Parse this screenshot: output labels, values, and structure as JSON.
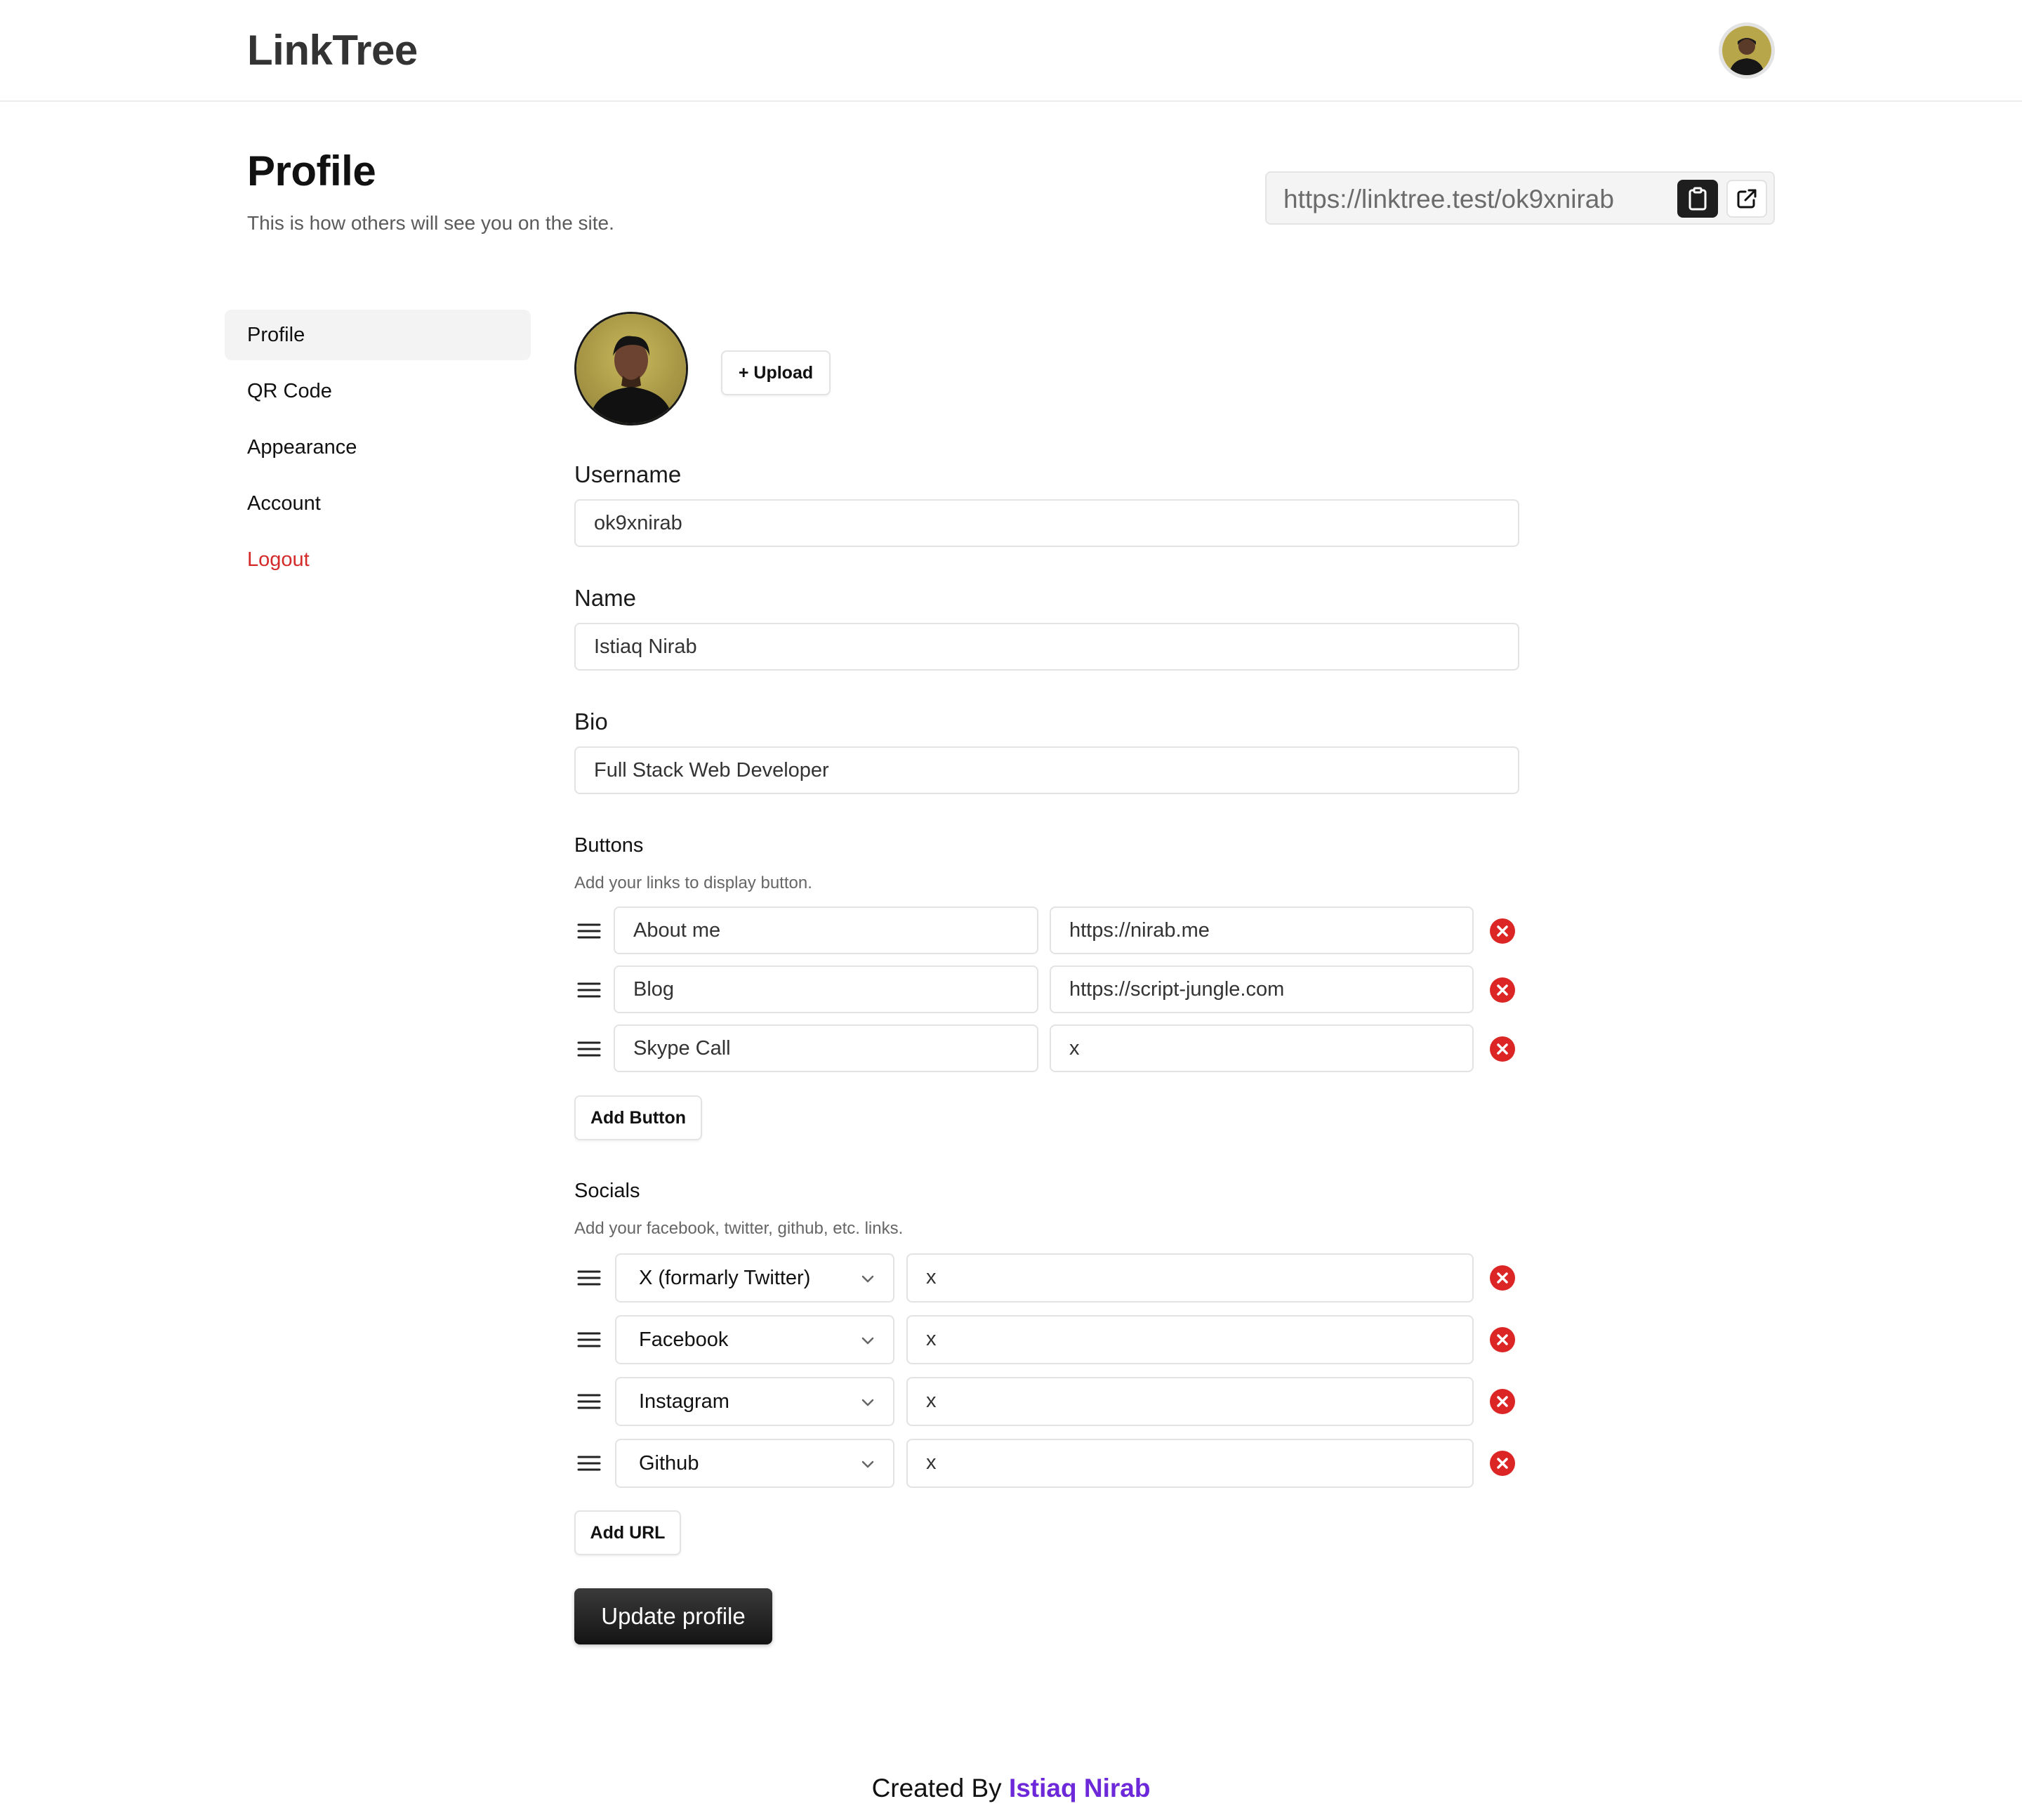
{
  "app": {
    "name": "LinkTree"
  },
  "header": {
    "avatar_alt": "user-avatar"
  },
  "page": {
    "title": "Profile",
    "subtitle": "This is how others will see you on the site.",
    "public_url": "https://linktree.test/ok9xnirab"
  },
  "sidebar": {
    "items": [
      {
        "label": "Profile",
        "active": true
      },
      {
        "label": "QR Code"
      },
      {
        "label": "Appearance"
      },
      {
        "label": "Account"
      },
      {
        "label": "Logout",
        "danger": true
      }
    ]
  },
  "form": {
    "upload_label": "+ Upload",
    "username": {
      "label": "Username",
      "value": "ok9xnirab"
    },
    "name": {
      "label": "Name",
      "value": "Istiaq Nirab"
    },
    "bio": {
      "label": "Bio",
      "value": "Full Stack Web Developer"
    },
    "buttons_section": {
      "title": "Buttons",
      "description": "Add your links to display button.",
      "rows": [
        {
          "label": "About me",
          "url": "https://nirab.me"
        },
        {
          "label": "Blog",
          "url": "https://script-jungle.com"
        },
        {
          "label": "Skype Call",
          "url": "x"
        }
      ],
      "add_label": "Add Button"
    },
    "socials_section": {
      "title": "Socials",
      "description": "Add your facebook, twitter, github, etc. links.",
      "rows": [
        {
          "platform": "X (formarly Twitter)",
          "url": "x"
        },
        {
          "platform": "Facebook",
          "url": "x"
        },
        {
          "platform": "Instagram",
          "url": "x"
        },
        {
          "platform": "Github",
          "url": "x"
        }
      ],
      "add_label": "Add URL"
    },
    "submit_label": "Update profile"
  },
  "footer": {
    "prefix": "Created By",
    "author": "Istiaq Nirab"
  },
  "colors": {
    "danger": "#dc2626",
    "accent": "#6d28d9",
    "primary": "#1e1e1e"
  }
}
